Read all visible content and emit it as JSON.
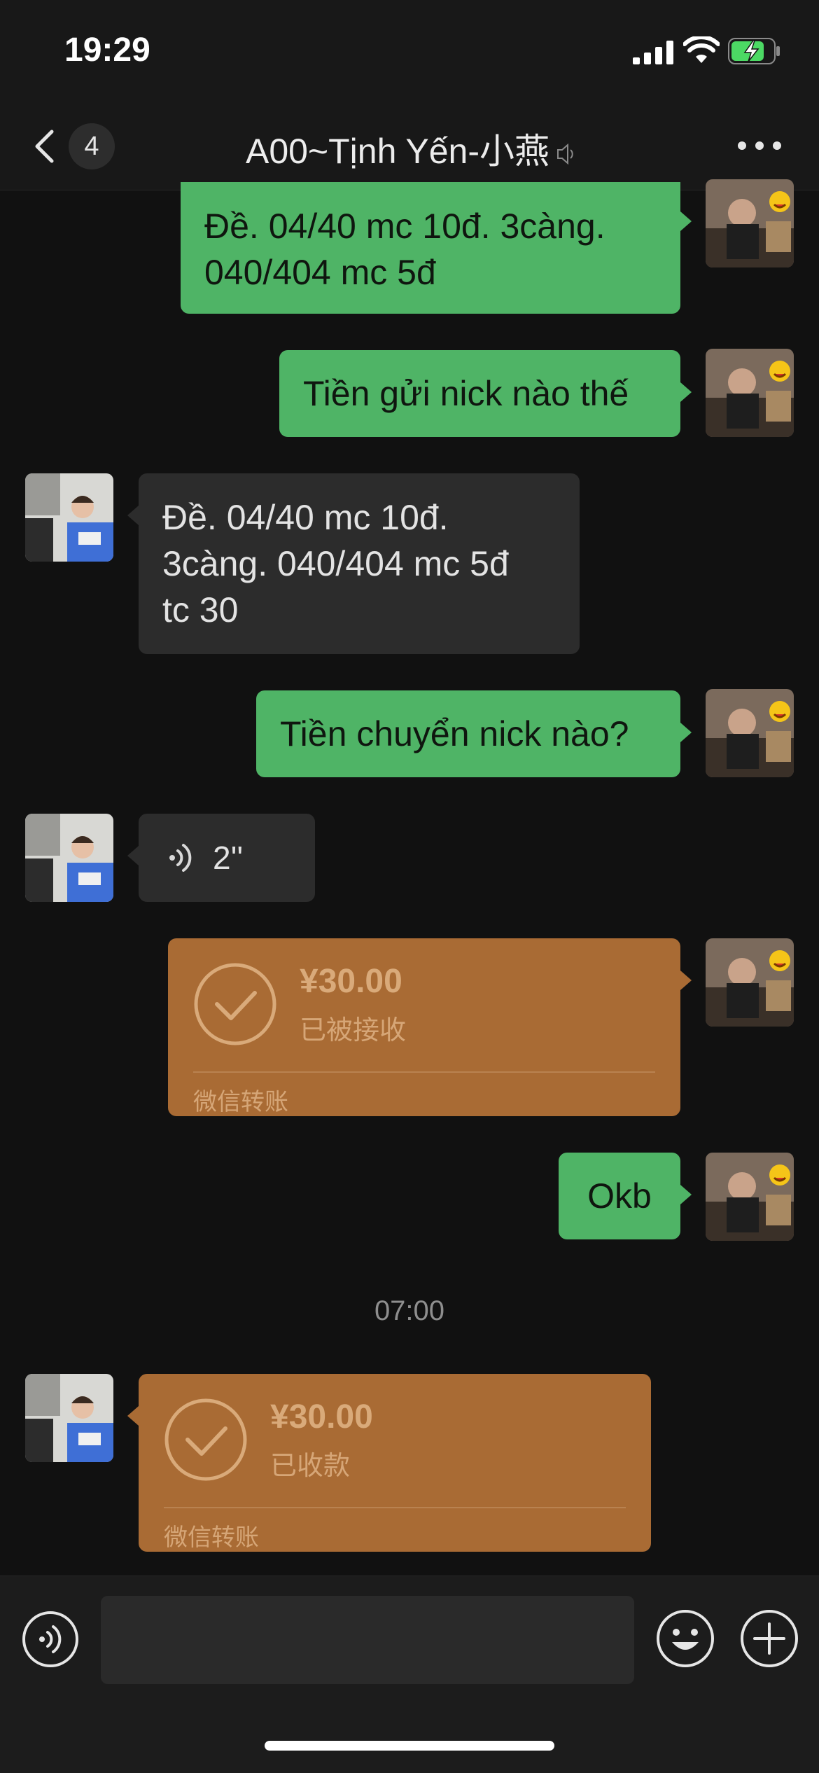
{
  "status_bar": {
    "time": "19:29"
  },
  "nav": {
    "unread_count": "4",
    "title": "A00~Tịnh Yến-小燕"
  },
  "messages": [
    {
      "side": "right",
      "type": "text",
      "text_lines": [
        "Đề. 04/40 mc 10đ. 3càng.",
        "040/404 mc 5đ"
      ]
    },
    {
      "side": "right",
      "type": "text",
      "text": "Tiền gửi nick nào thế"
    },
    {
      "side": "left",
      "type": "text",
      "text_lines": [
        "Đề. 04/40 mc 10đ.",
        "3càng. 040/404 mc 5đ",
        "tc 30"
      ]
    },
    {
      "side": "right",
      "type": "text",
      "text": "Tiền chuyển nick nào?"
    },
    {
      "side": "left",
      "type": "voice",
      "duration": "2''"
    },
    {
      "side": "right",
      "type": "transfer",
      "amount": "¥30.00",
      "status": "已被接收",
      "brand": "微信转账"
    },
    {
      "side": "right",
      "type": "text",
      "text": "Okb"
    },
    {
      "side": "left",
      "type": "transfer",
      "amount": "¥30.00",
      "status": "已收款",
      "brand": "微信转账"
    }
  ],
  "timestamp": "07:00",
  "input": {
    "placeholder": ""
  },
  "icons": {
    "voice_toggle": "voice-mode-icon",
    "emoji": "emoji-icon",
    "plus": "plus-icon",
    "more": "more-icon",
    "back": "chevron-left-icon",
    "mute": "mute-bell-icon"
  },
  "colors": {
    "background": "#111111",
    "green_bubble": "#4fb466",
    "gray_bubble": "#2c2c2c",
    "transfer_bubble": "#a96b34"
  }
}
